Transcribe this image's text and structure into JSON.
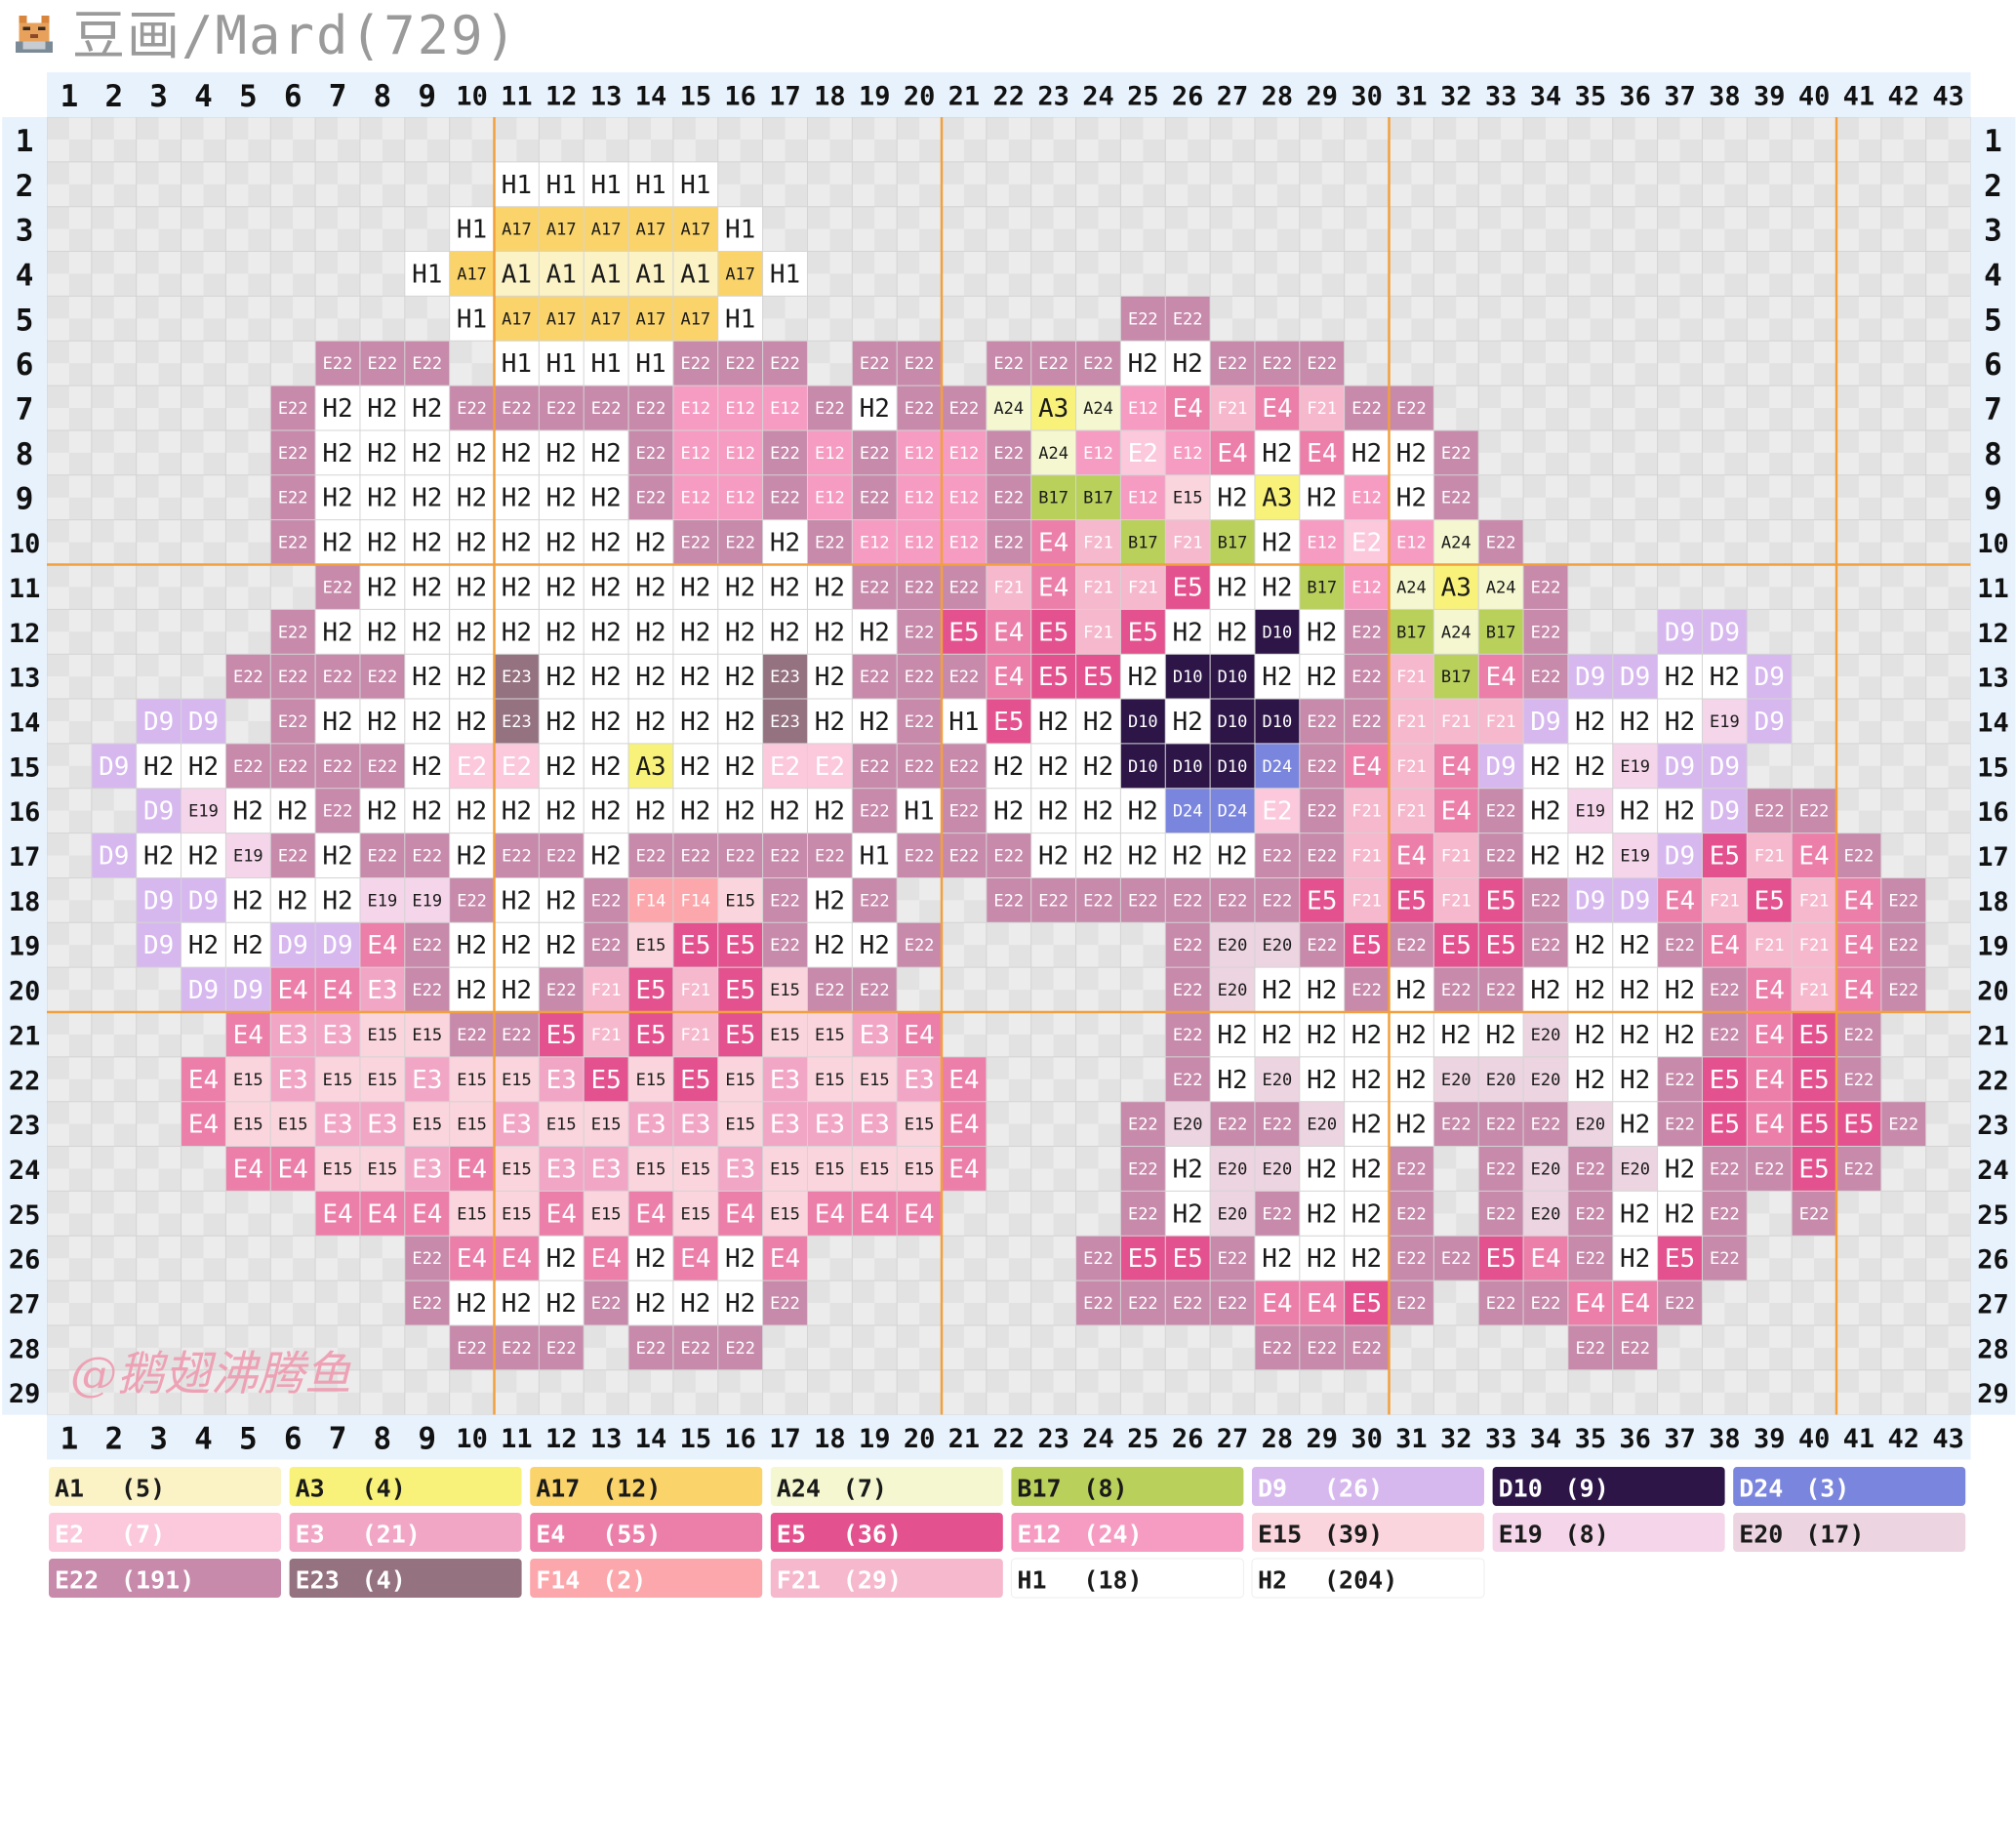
{
  "header": {
    "title": "豆画/Mard(729)",
    "logo_icon": "pixel-cat-icon"
  },
  "grid": {
    "col_numbers": [
      "1",
      "2",
      "3",
      "4",
      "5",
      "6",
      "7",
      "8",
      "9",
      "10",
      "11",
      "12",
      "13",
      "14",
      "15",
      "16",
      "17",
      "18",
      "19",
      "20",
      "21",
      "22",
      "23",
      "24",
      "25",
      "26",
      "27",
      "28",
      "29",
      "30",
      "31",
      "32",
      "33",
      "34",
      "35",
      "36",
      "37",
      "38",
      "39",
      "40",
      "41",
      "42",
      "43"
    ],
    "row_numbers": [
      "1",
      "2",
      "3",
      "4",
      "5",
      "6",
      "7",
      "8",
      "9",
      "10",
      "11",
      "12",
      "13",
      "14",
      "15",
      "16",
      "17",
      "18",
      "19",
      "20",
      "21",
      "22",
      "23",
      "24",
      "25",
      "26",
      "27",
      "28",
      "29"
    ],
    "rows": [
      "",
      "11:H1 H1 H1 H1 H1",
      "10:H1 A17 A17 A17 A17 A17 H1",
      "9:H1 A17 A1 A1 A1 A1 A1 A17 H1",
      "10:H1 A17 A17 A17 A17 A17 H1|25:E22 E22",
      "7:E22 E22 E22|11:H1 H1 H1 H1 E22 E22 E22|19:E22 E22|22:E22 E22 E22 H2 H2 E22 E22 E22",
      "6:E22 H2 H2 H2 E22 E22 E22 E22 E22 E12 E12 E12 E22 H2 E22 E22 A24 A3 A24 E12 E4 F21 E4 F21 E22 E22",
      "6:E22 H2 H2 H2 H2 H2 H2 H2 E22 E12 E12 E22 E12 E22 E12 E12 E22 A24 E12 E2 E12 E4 H2 E4 H2 H2 E22",
      "6:E22 H2 H2 H2 H2 H2 H2 H2 E22 E12 E12 E22 E12 E22 E12 E12 E22 B17 B17 E12 E15 H2 A3 H2 E12 H2 E22",
      "6:E22 H2 H2 H2 H2 H2 H2 H2 H2 E22 E22 H2 E22 E12 E12 E12 E22 E4 F21 B17 F21 B17 H2 E12 E2 E12 A24 E22",
      "7:E22 H2 H2 H2 H2 H2 H2 H2 H2 H2 H2 H2 E22 E22 E22 F21 E4 F21 F21 E5 H2 H2 B17 E12 A24 A3 A24 E22",
      "6:E22 H2 H2 H2 H2 H2 H2 H2 H2 H2 H2 H2 H2 H2 E22 E5 E4 E5 F21 E5 H2 H2 D10 H2 E22 B17 A24 B17 E22|37:D9 D9",
      "5:E22 E22 E22 E22 H2 H2 E23 H2 H2 H2 H2 H2 E23 H2 E22 E22 E22 E4 E5 E5 H2 D10 D10 H2 H2 E22 F21 B17 E4 E22 D9 D9 H2 H2 D9",
      "3:D9 D9|6:E22 H2 H2 H2 H2 E23 H2 H2 H2 H2 H2 E23 H2 H2 E22 H1 E5 H2 H2 D10 H2 D10 D10 E22 E22 F21 F21 F21 D9 H2 H2 H2 E19 D9",
      "2:D9 H2 H2 E22 E22 E22 E22 H2 E2 E2 H2 H2 A3 H2 H2 E2 E2 E22 E22 E22 H2 H2 H2 D10 D10 D10 D24 E22 E4 F21 E4 D9 H2 H2 E19 D9 D9",
      "3:D9 E19 H2 H2 E22 H2 H2 H2 H2 H2 H2 H2 H2 H2 H2 H2 E22 H1 E22 H2 H2 H2 H2 D24 D24 E2 E22 F21 F21 E4 E22 H2 E19 H2 H2 D9 E22 E22",
      "2:D9 H2 H2 E19 E22 H2 E22 E22 H2 E22 E22 H2 E22 E22 E22 E22 E22 H1 E22 E22 E22 H2 H2 H2 H2 H2 E22 E22 F21 E4 F21 E22 H2 H2 E19 D9 E5 F21 E4 E22",
      "3:D9 D9 H2 H2 H2 E19 E19 E22 H2 H2 E22 F14 F14 E15 E22 H2 E22|22:E22 E22 E22 E22 E22 E22 E22 E5 F21 E5 F21 E5 E22 D9 D9 E4 F21 E5 F21 E4 E22",
      "3:D9 H2 H2 D9 D9 E4 E22 H2 H2 H2 E22 E15 E5 E5 E22 H2 H2 E22|26:E22 E20 E20 E22 E5 E22 E5 E5 E22 H2 H2 E22 E4 F21 F21 E4 E22",
      "4:D9 D9 E4 E4 E3 E22 H2 H2 E22 F21 E5 F21 E5 E15 E22 E22|26:E22 E20 H2 H2 E22 H2 E22 E22 H2 H2 H2 H2 E22 E4 F21 E4 E22",
      "5:E4 E3 E3 E15 E15 E22 E22 E5 F21 E5 F21 E5 E15 E15 E3 E4|26:E22 H2 H2 H2 H2 H2 H2 H2 E20 H2 H2 H2 E22 E4 E5 E22",
      "4:E4 E15 E3 E15 E15 E3 E15 E15 E3 E5 E15 E5 E15 E3 E15 E15 E3 E4|26:E22 H2 E20 H2 H2 H2 E20 E20 E20 H2 H2 E22 E5 E4 E5 E22",
      "4:E4 E15 E15 E3 E3 E15 E15 E3 E15 E15 E3 E3 E15 E3 E3 E3 E15 E4|25:E22 E20 E22 E22 E20 H2 H2 E22 E22 E22 E20 H2 E22 E5 E4 E5 E5 E22",
      "5:E4 E4 E15 E15 E3 E4 E15 E3 E3 E15 E15 E3 E15 E15 E15 E15 E4|25:E22 H2 E20 E20 H2 H2 E22|33:E22 E20 E22 E20 H2 E22 E22 E5 E22",
      "7:E4 E4 E4 E15 E15 E4 E15 E4 E15 E4 E15 E4 E4 E4|25:E22 H2 E20 E22 H2 H2 E22|33:E22 E20 E22 H2 H2 E22|40:E22",
      "9:E22 E4 E4 H2 E4 H2 E4 H2 E4|24:E22 E5 E5 E22 H2 H2 H2 E22 E22 E5 E4 E22 H2 E5 E22",
      "9:E22 H2 H2 H2 E22 H2 H2 H2 E22|24:E22 E22 E22 E22 E4 E4 E5 E22|33:E22 E22 E4 E4 E22",
      "10:E22 E22 E22|14:E22 E22 E22|28:E22 E22 E22|35:E22 E22",
      ""
    ]
  },
  "palette": {
    "A1": "#fbf3c6",
    "A3": "#f8f27a",
    "A17": "#fad46a",
    "A24": "#f4f7cf",
    "B17": "#b9d05b",
    "D9": "#d6b8ef",
    "D10": "#2d1647",
    "D24": "#7a85dd",
    "E2": "#fbc8dc",
    "E3": "#f2a6c6",
    "E4": "#ec7fa9",
    "E5": "#e3528e",
    "E12": "#f69cc2",
    "E15": "#fad5dd",
    "E19": "#f5d5ea",
    "E20": "#ecd4e0",
    "E22": "#c78aab",
    "E23": "#94727f",
    "F14": "#fca7ab",
    "F21": "#f6b8cc",
    "H1": "#ffffff",
    "H2": "#ffffff"
  },
  "dark_text_codes": [
    "A1",
    "A3",
    "A17",
    "A24",
    "B17",
    "E15",
    "E19",
    "E20",
    "H1",
    "H2"
  ],
  "legend": [
    {
      "code": "A1",
      "count": "(5)"
    },
    {
      "code": "A3",
      "count": "(4)"
    },
    {
      "code": "A17",
      "count": "(12)"
    },
    {
      "code": "A24",
      "count": "(7)"
    },
    {
      "code": "B17",
      "count": "(8)"
    },
    {
      "code": "D9",
      "count": "(26)"
    },
    {
      "code": "D10",
      "count": "(9)"
    },
    {
      "code": "D24",
      "count": "(3)"
    },
    {
      "code": "E2",
      "count": "(7)"
    },
    {
      "code": "E3",
      "count": "(21)"
    },
    {
      "code": "E4",
      "count": "(55)"
    },
    {
      "code": "E5",
      "count": "(36)"
    },
    {
      "code": "E12",
      "count": "(24)"
    },
    {
      "code": "E15",
      "count": "(39)"
    },
    {
      "code": "E19",
      "count": "(8)"
    },
    {
      "code": "E20",
      "count": "(17)"
    },
    {
      "code": "E22",
      "count": "(191)"
    },
    {
      "code": "E23",
      "count": "(4)"
    },
    {
      "code": "F14",
      "count": "(2)"
    },
    {
      "code": "F21",
      "count": "(29)"
    },
    {
      "code": "H1",
      "count": "(18)"
    },
    {
      "code": "H2",
      "count": "(204)"
    }
  ],
  "signature": {
    "text": "@鹅翅沸腾鱼",
    "color": "#ef9ab0"
  }
}
